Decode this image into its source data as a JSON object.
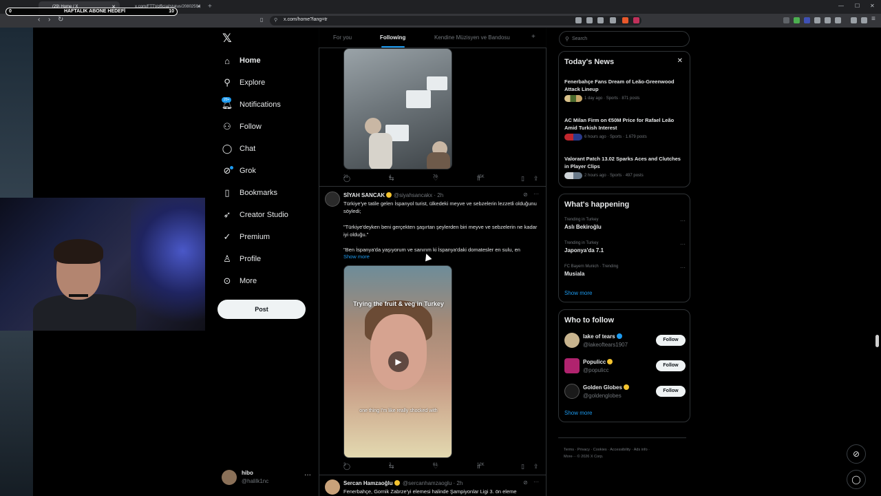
{
  "browser": {
    "tabs": [
      {
        "label": "(29) Home / X"
      },
      {
        "label": "x.com/FTTVofficial/status/20802594"
      }
    ],
    "url": "x.com/home?lang=tr"
  },
  "overlay": {
    "subgoal_current": "0",
    "subgoal_title": "HAFTALIK ABONE HEDEFİ",
    "subgoal_target": "10"
  },
  "nav": {
    "home": "Home",
    "explore": "Explore",
    "notifications": "Notifications",
    "notifications_badge": "20+",
    "follow": "Follow",
    "chat": "Chat",
    "grok": "Grok",
    "bookmarks": "Bookmarks",
    "creator_studio": "Creator Studio",
    "premium": "Premium",
    "profile": "Profile",
    "more": "More",
    "post": "Post"
  },
  "account": {
    "name": "hibo",
    "handle": "@halilk1nc"
  },
  "timeline_tabs": [
    "For you",
    "Following",
    "Kendine Müzisyen ve Bandosu"
  ],
  "tweets": [
    {
      "actions": {
        "replies": "21",
        "reposts": "4",
        "likes": "79",
        "views": "45K"
      }
    },
    {
      "name": "SİYAH SANCAK",
      "handle": "@siyahsancakx · 2h",
      "text1": "Türkiye'ye tatile gelen İspanyol turist, ülkedeki meyve ve sebzelerin lezzetli olduğunu söyledi;",
      "text2": "\"Türkiye'deyken beni gerçekten şaşırtan şeylerden biri meyve ve sebzelerin ne kadar iyi olduğu.\"",
      "text3": "\"Ben İspanya'da yaşıyorum ve sanırım ki İspanya'daki domatesler en sulu, en",
      "show_more": "Show more",
      "video_caption_top": "Trying the fruit & veg in Turkey",
      "video_caption_bottom": "one thing I'm like really shocked with",
      "actions": {
        "replies": "3",
        "reposts": "2",
        "likes": "61",
        "views": "12K"
      }
    },
    {
      "name": "Sercan Hamzaoğlu",
      "handle": "@sercanhamzaoglu · 2h",
      "text1": "Fenerbahçe, Gornik Zabrze'yi elemesi halinde Şampiyonlar Ligi 3. ön eleme"
    }
  ],
  "search": {
    "placeholder": "Search"
  },
  "todays_news": {
    "title": "Today's News",
    "items": [
      {
        "headline": "Fenerbahçe Fans Dream of Leão-Greenwood Attack Lineup",
        "meta": "1 day ago · Sports · 871 posts"
      },
      {
        "headline": "AC Milan Firm on €50M Price for Rafael Leão Amid Turkish Interest",
        "meta": "6 hours ago · Sports · 1.679 posts"
      },
      {
        "headline": "Valorant Patch 13.02 Sparks Aces and Clutches in Player Clips",
        "meta": "2 hours ago · Sports · 497 posts"
      }
    ]
  },
  "whats_happening": {
    "title": "What's happening",
    "items": [
      {
        "context": "Trending in Turkey",
        "name": "Aslı Bekiroğlu"
      },
      {
        "context": "Trending in Turkey",
        "name": "Japonya'da 7.1"
      },
      {
        "context": "FC Bayern Munich · Trending",
        "name": "Musiala"
      }
    ],
    "show_more": "Show more"
  },
  "who_to_follow": {
    "title": "Who to follow",
    "items": [
      {
        "name": "lake of tears",
        "handle": "@lakeoftears1907",
        "button": "Follow"
      },
      {
        "name": "Populicc",
        "handle": "@populicc",
        "button": "Follow"
      },
      {
        "name": "Golden Globes",
        "handle": "@goldenglobes",
        "button": "Follow"
      }
    ],
    "show_more": "Show more"
  },
  "footer": {
    "line1": "Terms · Privacy · Cookies · Accessibility · Ads info ·",
    "line2": "More··· © 2026 X Corp."
  },
  "colors": {
    "accent": "#1d9bf0",
    "background": "#000000",
    "text": "#e7e9ea",
    "muted": "#71767b"
  }
}
